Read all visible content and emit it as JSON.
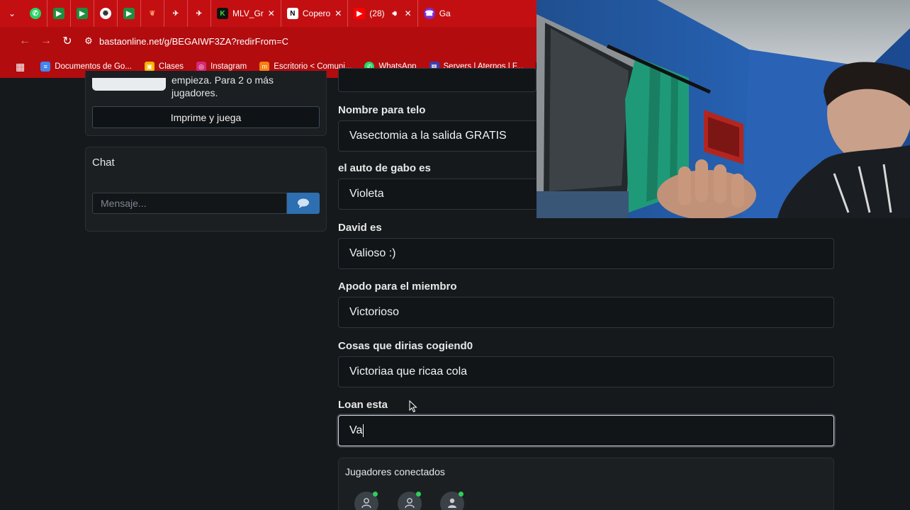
{
  "browser": {
    "tabs": [
      {
        "icon": "whatsapp-icon",
        "title": ""
      },
      {
        "icon": "meet-icon",
        "title": ""
      },
      {
        "icon": "meet-icon",
        "title": ""
      },
      {
        "icon": "chatgpt-icon",
        "title": ""
      },
      {
        "icon": "meet-icon",
        "title": ""
      },
      {
        "icon": "bookmark-icon",
        "title": ""
      },
      {
        "icon": "extension-icon",
        "title": ""
      },
      {
        "icon": "extension-icon",
        "title": ""
      },
      {
        "icon": "k-icon",
        "title": "MLV_Gr"
      },
      {
        "icon": "notion-icon",
        "title": "Copero"
      },
      {
        "icon": "youtube-icon",
        "title": "(28)"
      },
      {
        "icon": "game-icon",
        "title": "Ga"
      }
    ],
    "url": "bastaonline.net/g/BEGAIWF3ZA?redirFrom=C",
    "bookmarks": [
      {
        "icon": "docs-icon",
        "label": "Documentos de Go..."
      },
      {
        "icon": "classroom-icon",
        "label": "Clases"
      },
      {
        "icon": "instagram-icon",
        "label": "Instagram"
      },
      {
        "icon": "moodle-icon",
        "label": "Escritorio < Comuni..."
      },
      {
        "icon": "whatsapp-icon",
        "label": "WhatsApp"
      },
      {
        "icon": "aternos-icon",
        "label": "Servers | Aternos | F..."
      }
    ],
    "colors": {
      "chrome": "#c40f12",
      "chrome_dark": "#b20c0f"
    }
  },
  "left": {
    "intro_text": "empieza. Para 2 o más jugadores.",
    "print_button": "Imprime y juega",
    "chat": {
      "title": "Chat",
      "placeholder": "Mensaje..."
    }
  },
  "form": {
    "fields": [
      {
        "label": "Nombre para telo",
        "value": "Vasectomia a la salida GRATIS"
      },
      {
        "label": "el auto de gabo es",
        "value": "Violeta"
      },
      {
        "label": "David es",
        "value": "Valioso :)"
      },
      {
        "label": "Apodo para el miembro",
        "value": "Victorioso"
      },
      {
        "label": "Cosas que dirias cogiend0",
        "value": "Victoriaa que ricaa cola"
      },
      {
        "label": "Loan esta",
        "value": "Va"
      }
    ]
  },
  "players": {
    "title": "Jugadores conectados",
    "count": 3
  },
  "accent_colors": {
    "online": "#2fcf5a",
    "send_button": "#2d6fb0"
  }
}
